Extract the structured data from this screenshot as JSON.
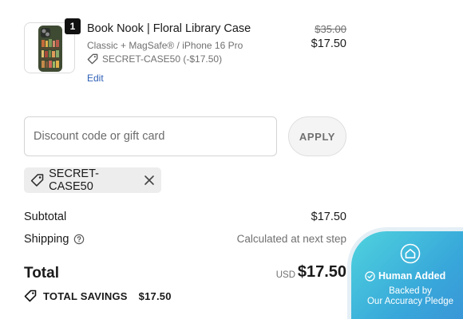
{
  "line_item": {
    "quantity": "1",
    "name": "Book Nook | Floral Library Case",
    "variant": "Classic + MagSafe® / iPhone 16 Pro",
    "discount": "SECRET-CASE50 (-$17.50)",
    "edit_label": "Edit",
    "original_price": "$35.00",
    "price": "$17.50",
    "image_icon": "phone-case-thumbnail"
  },
  "discount_form": {
    "placeholder": "Discount code or gift card",
    "value": "",
    "apply_label": "APPLY"
  },
  "applied_code": {
    "code": "SECRET-CASE50",
    "tag_icon": "tag-icon",
    "remove_icon": "close-icon"
  },
  "summary": {
    "subtotal_label": "Subtotal",
    "subtotal_value": "$17.50",
    "shipping_label": "Shipping",
    "shipping_value": "Calculated at next step",
    "shipping_help_icon": "question-circle-icon"
  },
  "total": {
    "label": "Total",
    "currency": "USD",
    "amount": "$17.50"
  },
  "savings": {
    "label": "TOTAL SAVINGS",
    "amount": "$17.50"
  },
  "pledge_badge": {
    "title": "Human Added",
    "line1": "Backed by",
    "line2": "Our Accuracy Pledge",
    "colors": {
      "start": "#4fd3de",
      "end": "#3a8fd6"
    }
  },
  "colors": {
    "link": "#2d5fb6",
    "muted_text": "#707070",
    "primary_text": "#1a1a1a"
  }
}
